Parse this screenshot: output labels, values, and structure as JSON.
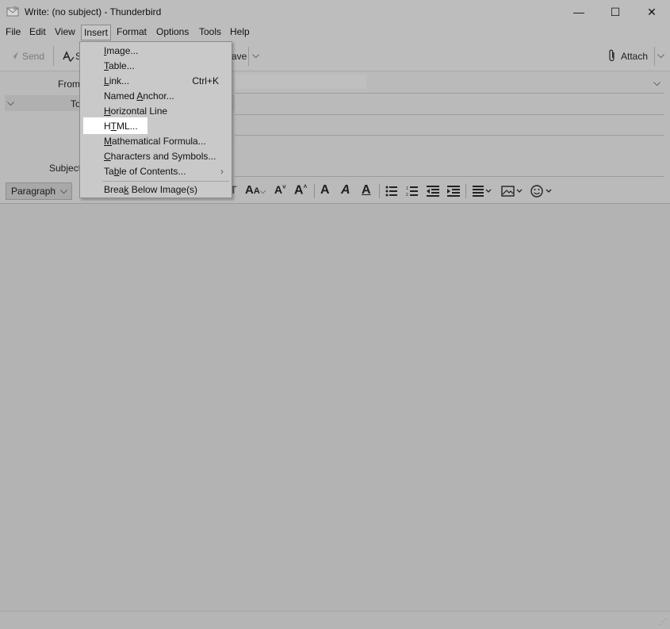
{
  "window": {
    "title": "Write: (no subject) - Thunderbird",
    "minimize_glyph": "—",
    "maximize_glyph": "☐",
    "close_glyph": "✕"
  },
  "menubar": {
    "file": "File",
    "edit": "Edit",
    "view": "View",
    "insert": "Insert",
    "format": "Format",
    "options": "Options",
    "tools": "Tools",
    "help": "Help"
  },
  "toolbar": {
    "send": "Send",
    "spelling_partial": "S",
    "save_partial": "ave",
    "attach": "Attach"
  },
  "headers": {
    "from_label": "From",
    "to_label": "To",
    "subject_label": "Subject"
  },
  "formatbar": {
    "paragraph": "Paragraph"
  },
  "insert_menu": {
    "items": [
      {
        "pre": "",
        "key": "I",
        "post": "mage...",
        "shortcut": ""
      },
      {
        "pre": "",
        "key": "T",
        "post": "able...",
        "shortcut": ""
      },
      {
        "pre": "",
        "key": "L",
        "post": "ink...",
        "shortcut": "Ctrl+K"
      },
      {
        "pre": "Named ",
        "key": "A",
        "post": "nchor...",
        "shortcut": ""
      },
      {
        "pre": "",
        "key": "H",
        "post": "orizontal Line",
        "shortcut": ""
      },
      {
        "pre": "H",
        "key": "T",
        "post": "ML...",
        "shortcut": ""
      },
      {
        "pre": "",
        "key": "M",
        "post": "athematical Formula...",
        "shortcut": ""
      },
      {
        "pre": "",
        "key": "C",
        "post": "haracters and Symbols...",
        "shortcut": ""
      },
      {
        "pre": "Ta",
        "key": "b",
        "post": "le of Contents...",
        "shortcut": "›"
      },
      {
        "pre": "Brea",
        "key": "k",
        "post": " Below Image(s)",
        "shortcut": ""
      }
    ]
  }
}
